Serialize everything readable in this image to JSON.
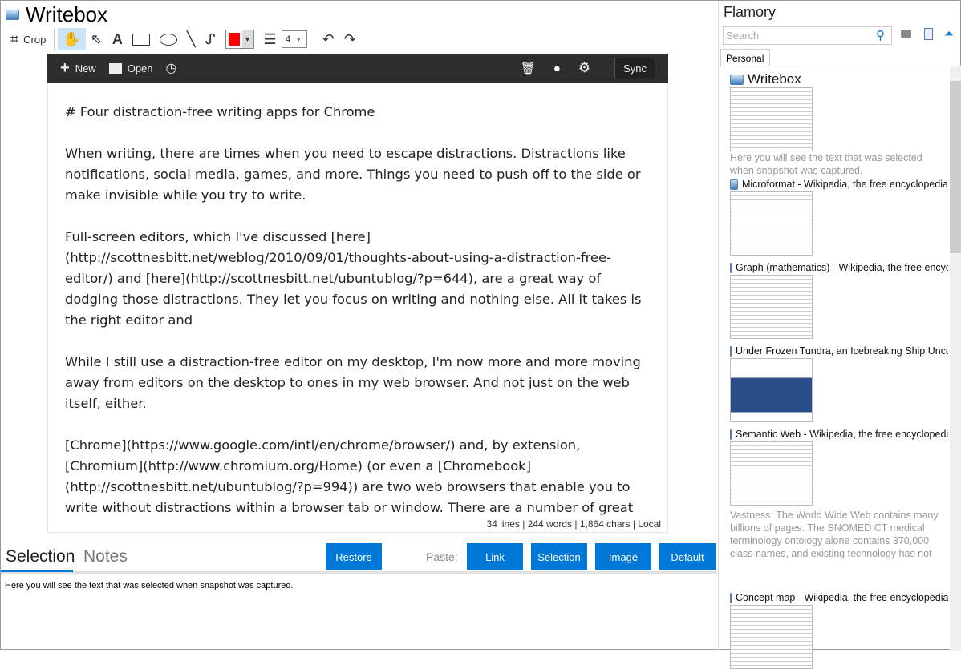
{
  "window": {
    "title": "Writebox"
  },
  "toolbar": {
    "crop": "Crop",
    "line_width": "4"
  },
  "editor_bar": {
    "new": "New",
    "open": "Open",
    "sync": "Sync"
  },
  "editor": {
    "paragraphs": [
      "# Four distraction-free writing apps for Chrome",
      "When writing, there are times when you need to escape distractions. Distractions like notifications, social media, games, and more. Things you need to push off to the side or make invisible while you try to write.",
      "Full-screen editors, which I've discussed [here](http://scottnesbitt.net/weblog/2010/09/01/thoughts-about-using-a-distraction-free-editor/) and [here](http://scottnesbitt.net/ubuntublog/?p=644), are a great way of dodging those distractions. They let you focus on writing and nothing else. All it takes is the right editor and",
      "While I still use a distraction-free editor on my desktop, I'm now more and more moving away from editors on the desktop to ones in my web browser. And not just on the web itself, either.",
      "[Chrome](https://www.google.com/intl/en/chrome/browser/) and, by extension, [Chromium](http://www.chromium.org/Home) (or even a [Chromebook](http://scottnesbitt.net/ubuntublog/?p=994)) are two web browsers that enable you to write without distractions within a browser tab or window. There are a number of great"
    ],
    "status": "34 lines | 244 words | 1,864 chars | Local"
  },
  "bottom": {
    "tab_selection": "Selection",
    "tab_notes": "Notes",
    "restore": "Restore",
    "paste_label": "Paste:",
    "link": "Link",
    "selection": "Selection",
    "image": "Image",
    "default": "Default",
    "selection_text": "Here you will see the text that was selected when snapshot was captured."
  },
  "flamory": {
    "title": "Flamory",
    "search_placeholder": "Search",
    "tab": "Personal",
    "entries": [
      {
        "title": "Writebox",
        "desc": "Here you will see the text that was selected when snapshot was captured."
      },
      {
        "title": "Microformat - Wikipedia, the free encyclopedia"
      },
      {
        "title": "Graph (mathematics) - Wikipedia, the free encyclopedia"
      },
      {
        "title": "Under Frozen Tundra, an Icebreaking Ship Uncovers"
      },
      {
        "title": "Semantic Web - Wikipedia, the free encyclopedia",
        "desc": "Vastness: The World Wide Web contains many billions of pages. The SNOMED CT medical terminology ontology alone contains 370,000 class names, and existing technology has not yet been able to eliminate all semantically duplicated terms. Any automated reasoning system will have to deal with truly huge inputs."
      },
      {
        "title": "Concept map - Wikipedia, the free encyclopedia"
      }
    ]
  },
  "colors": {
    "accent": "#0078d7",
    "pen": "#ff0000",
    "editor_bar": "#2e2e2e"
  }
}
